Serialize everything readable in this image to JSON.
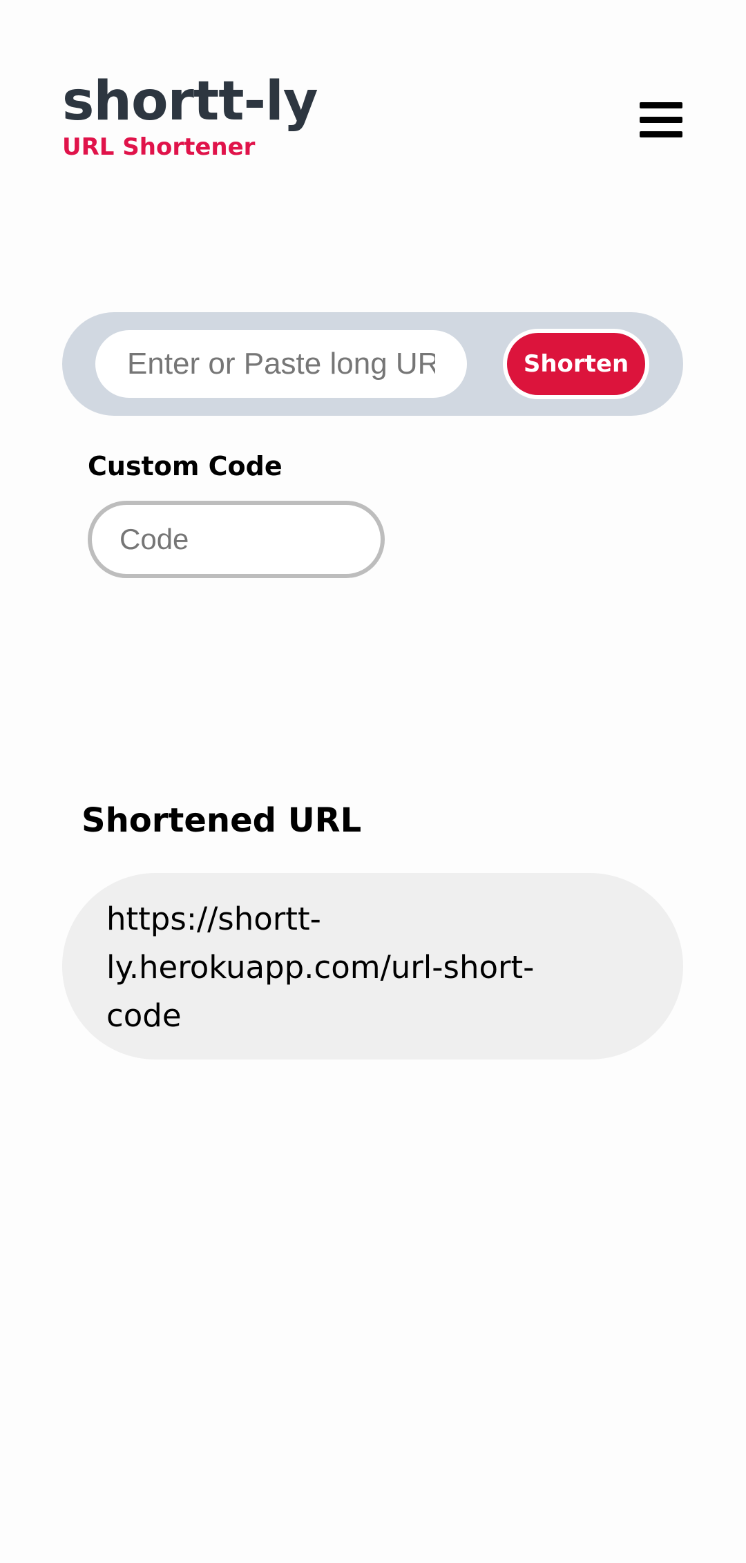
{
  "header": {
    "title": "shortt-ly",
    "subtitle": "URL Shortener",
    "menu_icon": "hamburger-menu-icon"
  },
  "form": {
    "url_placeholder": "Enter or Paste long URL",
    "url_value": "",
    "shorten_label": "Shorten",
    "custom_code_label": "Custom Code",
    "code_placeholder": "Code",
    "code_value": ""
  },
  "result": {
    "heading": "Shortened URL",
    "url_lines": [
      "https://shortt-",
      "ly.herokuapp.com/url-short-",
      "code"
    ]
  },
  "colors": {
    "brand_dark": "#2d3640",
    "accent": "#dc143c",
    "subtitle": "#e0134a",
    "bar_bg": "#d1d8e1",
    "result_bg": "#efefef"
  }
}
